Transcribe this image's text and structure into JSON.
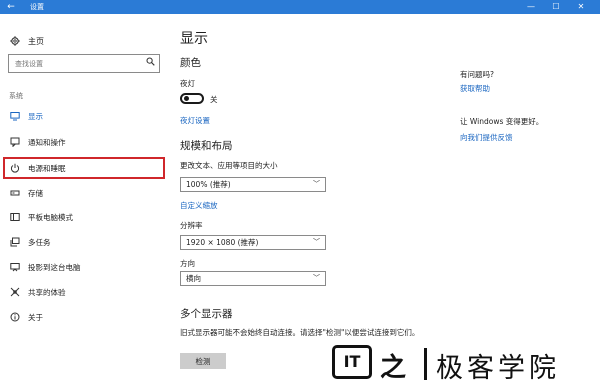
{
  "window": {
    "title": "设置",
    "back_glyph": "←",
    "min_glyph": "—",
    "max_glyph": "☐",
    "close_glyph": "✕"
  },
  "sidebar": {
    "home_label": "主页",
    "home_icon": "gear-icon",
    "search_placeholder": "查找设置",
    "search_icon": "search-icon",
    "section": "系统",
    "items": [
      {
        "label": "显示",
        "icon": "monitor-icon",
        "active": true
      },
      {
        "label": "通知和操作",
        "icon": "notification-icon"
      },
      {
        "label": "电源和睡眠",
        "icon": "power-icon",
        "highlighted": true
      },
      {
        "label": "存储",
        "icon": "storage-icon"
      },
      {
        "label": "平板电脑模式",
        "icon": "tablet-mode-icon"
      },
      {
        "label": "多任务",
        "icon": "multitasking-icon"
      },
      {
        "label": "投影到这台电脑",
        "icon": "project-icon"
      },
      {
        "label": "共享的体验",
        "icon": "shared-experience-icon"
      },
      {
        "label": "关于",
        "icon": "info-icon"
      }
    ]
  },
  "main": {
    "title": "显示",
    "color_heading": "颜色",
    "night_light_label": "夜灯",
    "night_light_state": "关",
    "night_light_link": "夜灯设置",
    "scale_heading": "规模和布局",
    "scale_label": "更改文本、应用等项目的大小",
    "scale_value": "100% (推荐)",
    "custom_scale_link": "自定义缩放",
    "resolution_label": "分辨率",
    "resolution_value": "1920 × 1080 (推荐)",
    "orientation_label": "方向",
    "orientation_value": "横向",
    "multi_display_heading": "多个显示器",
    "multi_display_desc": "旧式显示器可能不会始终自动连接。请选择\"检测\"以便尝试连接到它们。",
    "detect_button": "检测"
  },
  "right_panel": {
    "question": "有问题吗?",
    "get_help_link": "获取帮助",
    "improve_text": "让 Windows 变得更好。",
    "feedback_link": "向我们提供反馈"
  },
  "watermark": {
    "logo_text": "IT",
    "logo_symbol": "之",
    "brand": "极客学院"
  },
  "colors": {
    "titlebar": "#2b7bd6",
    "accent_link": "#1a66c1",
    "highlight_box": "#d0272b"
  }
}
